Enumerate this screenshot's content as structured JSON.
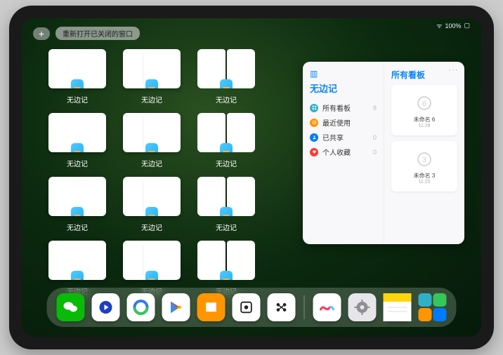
{
  "status": {
    "signal_icon": "signal-icon",
    "battery_text": "100%"
  },
  "top": {
    "plus_label": "+",
    "reopen_label": "重新打开已关闭的窗口"
  },
  "app_switcher": {
    "app_name": "无边记",
    "rows": [
      3,
      3,
      3,
      3
    ]
  },
  "panel": {
    "title": "无边记",
    "right_title": "所有看板",
    "more": "···",
    "items": [
      {
        "label": "所有看板",
        "count": 8,
        "color": "cyan"
      },
      {
        "label": "最近使用",
        "count": "",
        "color": "orange"
      },
      {
        "label": "已共享",
        "count": 0,
        "color": "blue"
      },
      {
        "label": "个人收藏",
        "count": 0,
        "color": "red"
      }
    ],
    "boards": [
      {
        "title": "未命名 6",
        "date": "11:28",
        "glyph": "6"
      },
      {
        "title": "未命名 3",
        "date": "11:25",
        "glyph": "3"
      }
    ]
  },
  "colors": {
    "accent": "#0a84ff",
    "wechat": "#09bb07",
    "white": "#ffffff",
    "qqbrowser": "#3478f6",
    "play_red": "#ea4335",
    "play_yellow": "#fbbc05",
    "play_green": "#34a853",
    "play_blue": "#4285f4",
    "books_orange": "#ff9500",
    "freeform": "#4fc9ff",
    "settings_gray": "#8e8e93",
    "notes_yellow": "#ffd60a"
  },
  "dock": {
    "apps": [
      "wechat",
      "tencent-video",
      "qq-browser",
      "google-play",
      "books",
      "generic-white",
      "generic-dots"
    ],
    "recent": [
      "freeform",
      "settings",
      "notes",
      "app-library"
    ]
  }
}
